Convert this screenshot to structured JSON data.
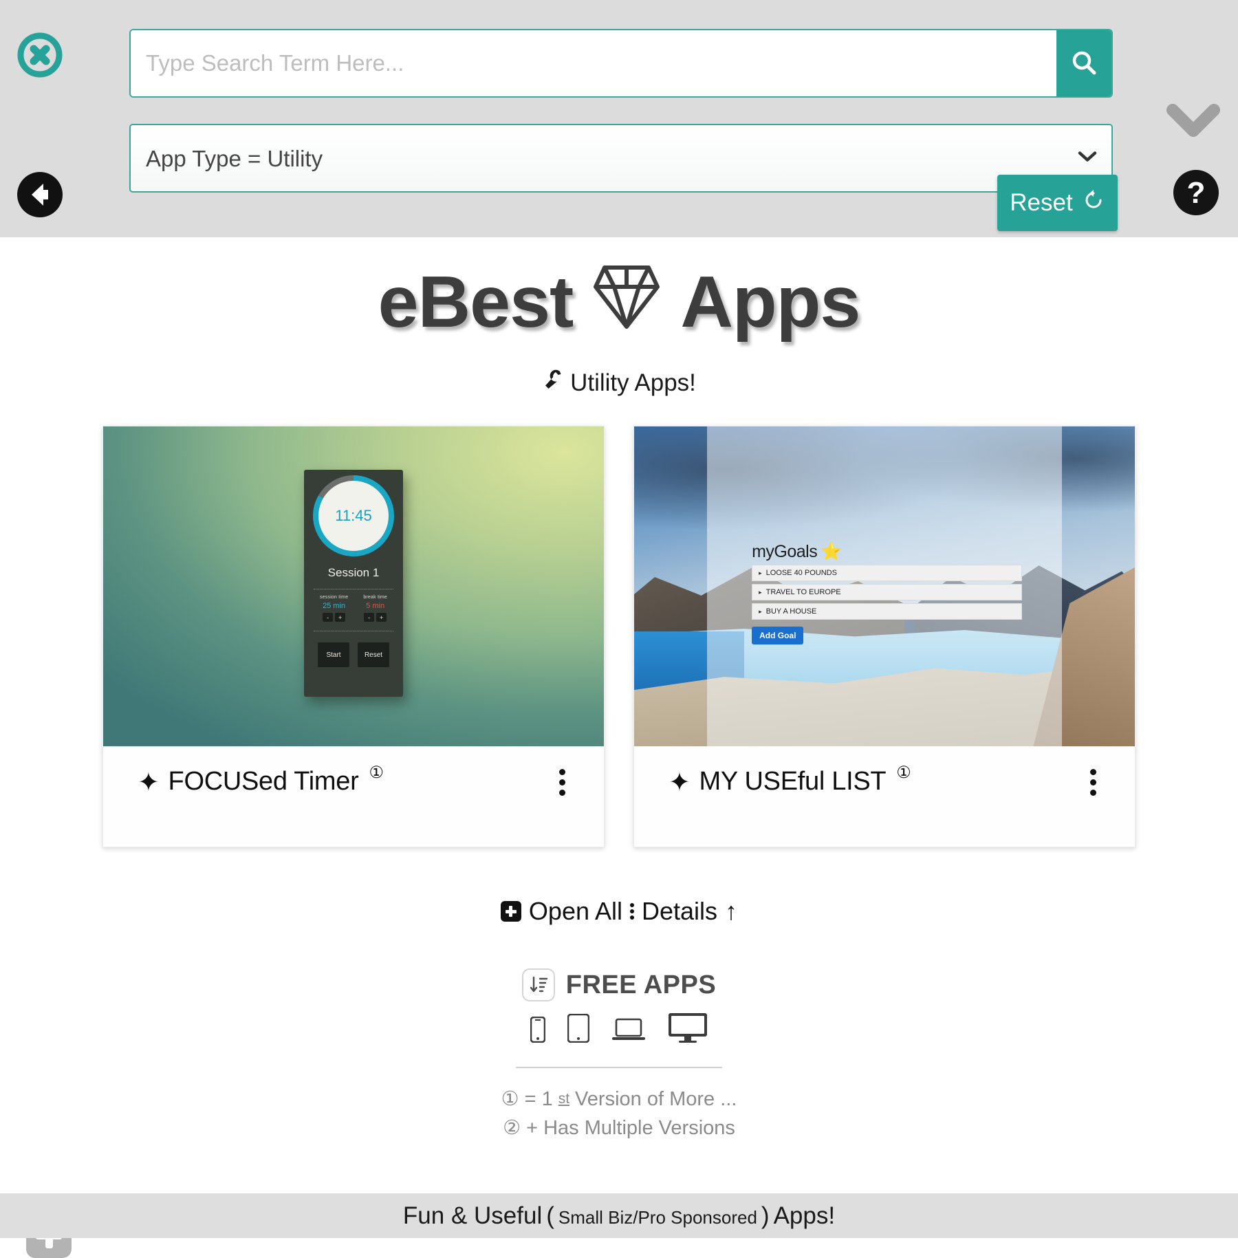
{
  "header": {
    "close_icon": "close-circle-icon",
    "back_icon": "back-arrow-icon",
    "collapse_icon": "chevron-down-icon",
    "help_icon": "question-mark-icon",
    "search": {
      "placeholder": "Type Search Term Here...",
      "value": "",
      "button_icon": "search-icon"
    },
    "filter": {
      "selected": "App Type = Utility",
      "options": [
        "App Type = Utility"
      ],
      "arrow_icon": "chevron-down-icon"
    },
    "reset": {
      "label": "Reset",
      "icon": "refresh-icon"
    }
  },
  "brand": {
    "title_left": "eBest",
    "title_right": "Apps",
    "gem_icon": "diamond-icon"
  },
  "subtitle": {
    "icon": "wrench-icon",
    "text": "Utility Apps!"
  },
  "cards": [
    {
      "name": "FOCUSed Timer",
      "bullet": "✦",
      "version_mark": "①",
      "menu_icon": "kebab-menu-icon",
      "preview": {
        "kind": "focus-timer",
        "time": "11:45",
        "session_label": "Session 1",
        "session_time_label": "session time",
        "session_time_value": "25 min",
        "break_time_label": "break time",
        "break_time_value": "5 min",
        "minus": "-",
        "plus": "+",
        "start": "Start",
        "reset": "Reset"
      }
    },
    {
      "name": "MY USEful LIST",
      "bullet": "✦",
      "version_mark": "①",
      "menu_icon": "kebab-menu-icon",
      "preview": {
        "kind": "my-goals",
        "title": "myGoals",
        "title_star": "⭐",
        "goals": [
          "LOOSE 40 POUNDS",
          "TRAVEL TO EUROPE",
          "BUY A HOUSE"
        ],
        "add_button": "Add Goal"
      }
    }
  ],
  "open_all_row": {
    "plus_icon": "plus-square-icon",
    "open_all": "Open All",
    "separator_icon": "kebab-menu-icon",
    "details": "Details",
    "up_arrow": "↑"
  },
  "free_apps": {
    "sort_icon": "sort-descending-icon",
    "label": "FREE APPS",
    "devices": [
      "mobile-icon",
      "tablet-icon",
      "laptop-icon",
      "desktop-icon"
    ]
  },
  "legend": {
    "line1_mark": "①",
    "line1_eq": "=",
    "line1_num": "1",
    "line1_sup": "st",
    "line1_text": "Version of More ...",
    "line2_mark": "②",
    "line2_text": "+ Has Multiple Versions"
  },
  "add_fab": {
    "icon": "plus-icon"
  },
  "footer": {
    "part1": "Fun & Useful",
    "paren_open": "(",
    "part_small": "Small Biz/Pro Sponsored",
    "paren_close": ")",
    "part2": "Apps!"
  },
  "colors": {
    "accent_teal": "#27a296",
    "header_bg": "#dcdcdc",
    "footer_bg": "#dedede",
    "add_goal_blue": "#1a6fce",
    "timer_cyan": "#19a7c4",
    "timer_red": "#e2543b"
  }
}
